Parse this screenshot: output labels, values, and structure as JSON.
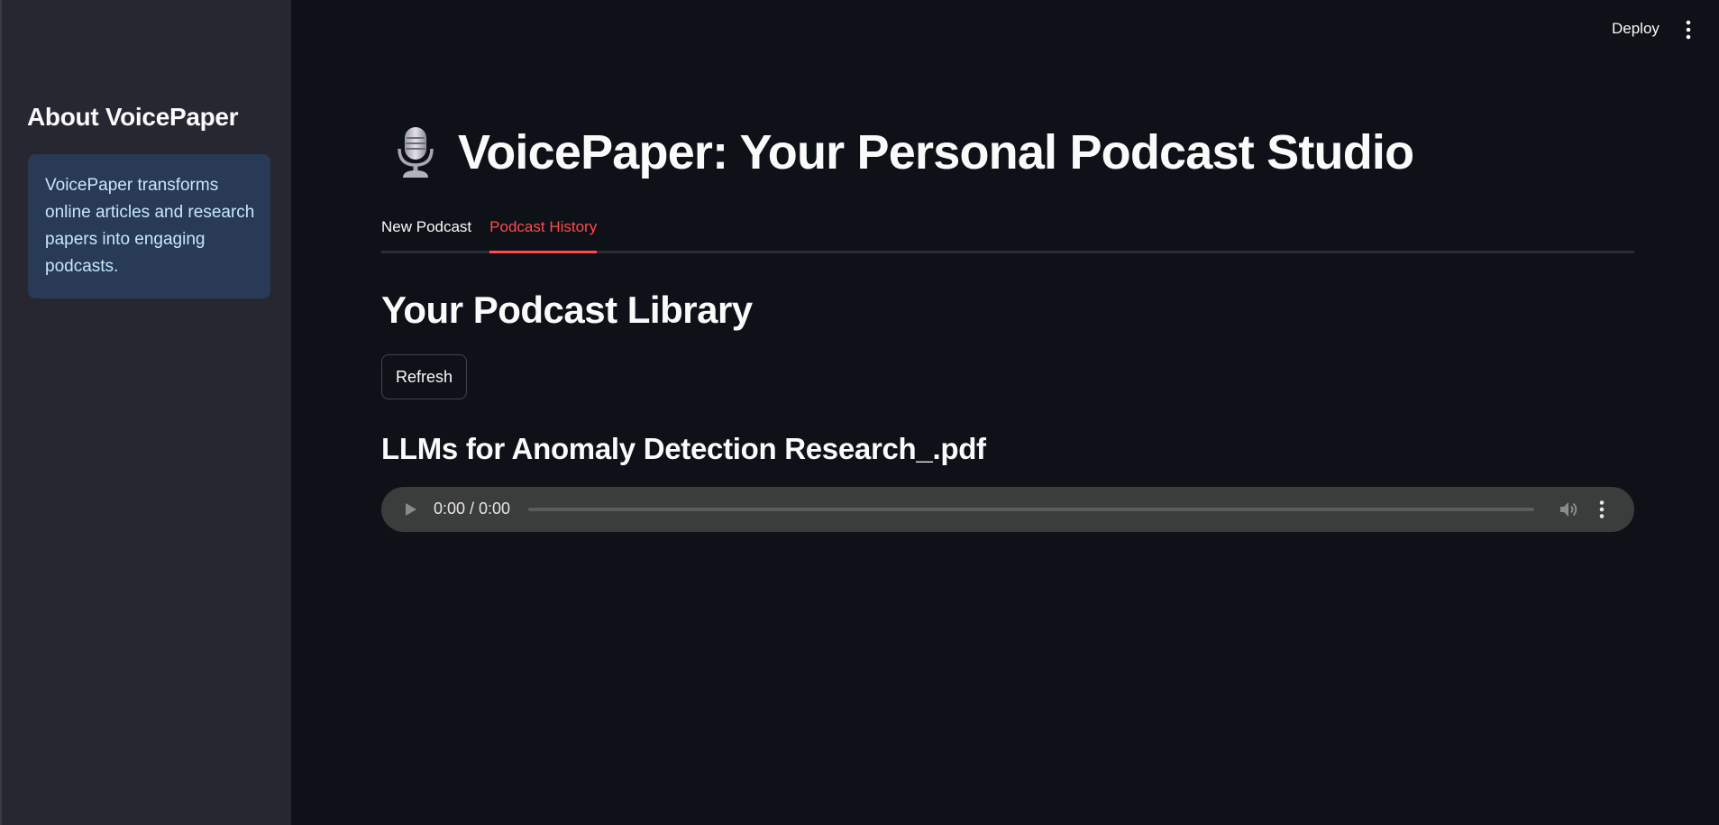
{
  "sidebar": {
    "title": "About VoicePaper",
    "info_text": "VoicePaper transforms online articles and research papers into engaging podcasts."
  },
  "header": {
    "deploy_label": "Deploy",
    "menu_icon": "vertical-ellipsis-icon"
  },
  "main": {
    "title_icon": "microphone-icon",
    "title": "VoicePaper: Your Personal Podcast Studio",
    "tabs": [
      {
        "label": "New Podcast",
        "active": false
      },
      {
        "label": "Podcast History",
        "active": true
      }
    ],
    "section_title": "Your Podcast Library",
    "refresh_label": "Refresh",
    "podcasts": [
      {
        "file_name": "LLMs for Anomaly Detection Research_.pdf",
        "audio": {
          "time_display": "0:00 / 0:00",
          "progress": 0
        }
      }
    ]
  },
  "colors": {
    "background": "#0e1117",
    "sidebar": "#262730",
    "info_box": "#283a55",
    "info_text": "#c7e6ff",
    "accent": "#ff4b4b",
    "player": "#3b3c3c"
  }
}
